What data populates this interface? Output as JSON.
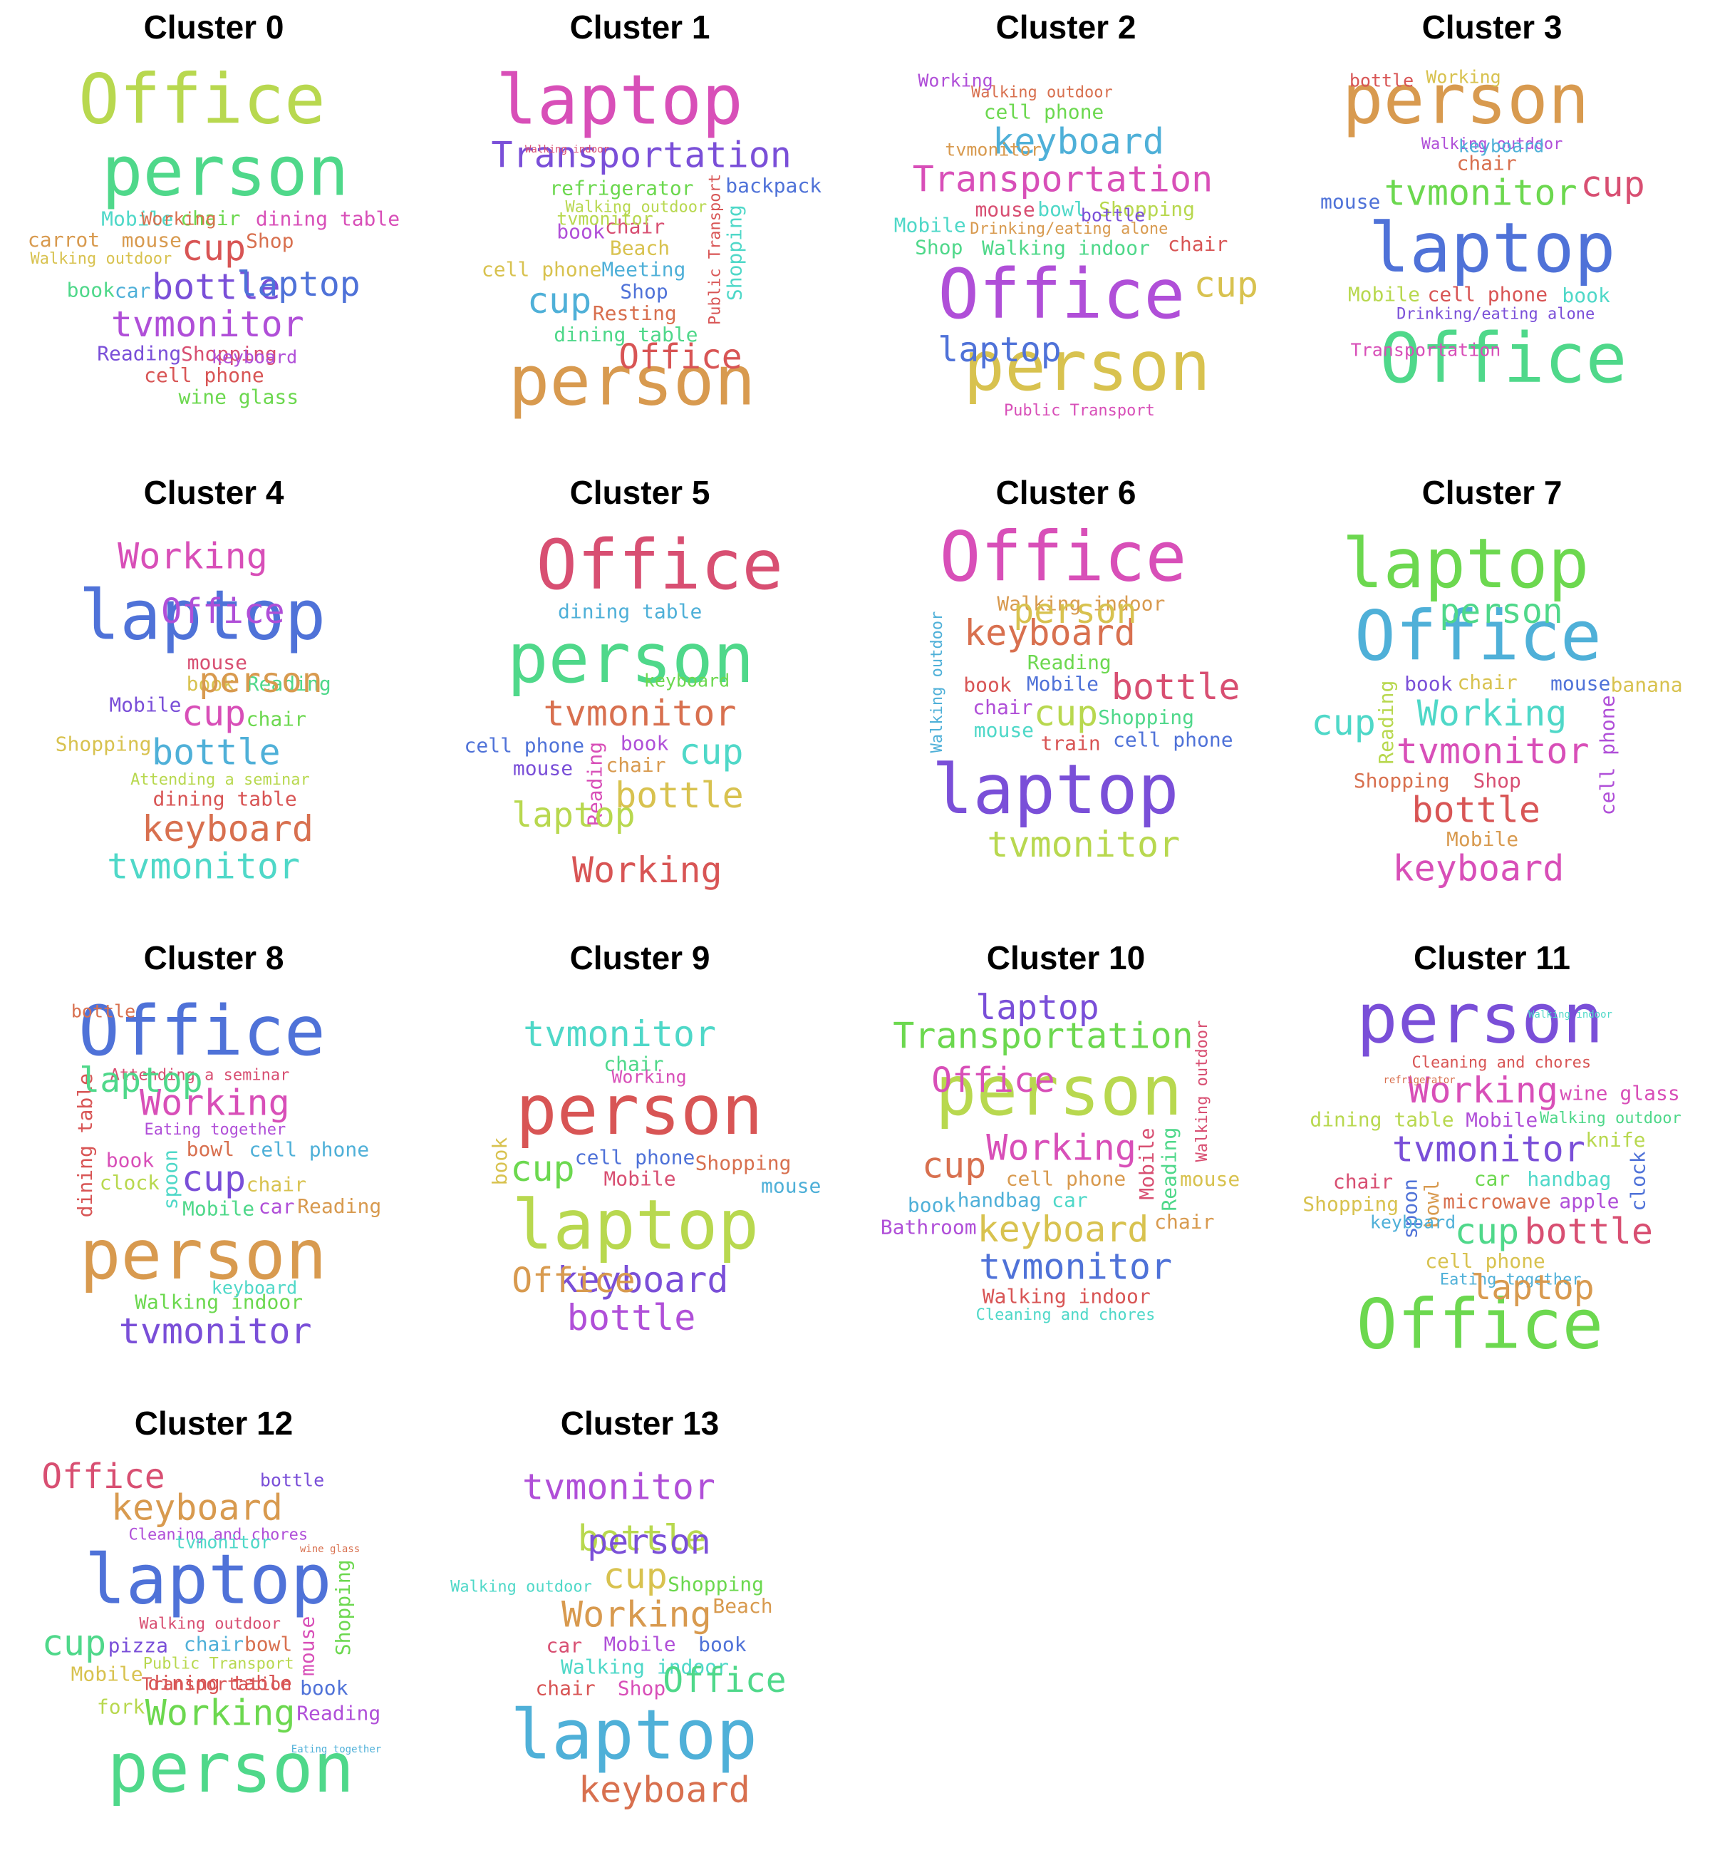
{
  "palette": [
    "#d85555",
    "#d8704f",
    "#d89a4f",
    "#d8c24f",
    "#b8d84f",
    "#6cd84f",
    "#4fd88a",
    "#4fd8c8",
    "#4fb0d8",
    "#4f72d8",
    "#7a4fd8",
    "#b04fd8",
    "#d84fb8",
    "#d84f72"
  ],
  "clusters": [
    {
      "title": "Cluster 0",
      "words": [
        "cup",
        "chair",
        "bottle",
        "Shop",
        "person",
        "tvmonitor",
        "mouse",
        "Mobile",
        "dining table",
        "Walking outdoor",
        "car",
        "Shopping",
        "Office",
        "laptop",
        "cell phone",
        "wine glass",
        "Reading",
        "Working",
        "book",
        "keyboard",
        "carrot"
      ]
    },
    {
      "title": "Cluster 1",
      "words": [
        "Beach",
        "Meeting",
        "chair",
        "Walking outdoor",
        "Shop",
        "Public Transport",
        "refrigerator",
        "Transportation",
        "Resting",
        "dining table",
        "book",
        "person",
        "Shopping",
        "laptop",
        "cell phone",
        "cup",
        "Walking indoor",
        "tvmonitor",
        "backpack",
        "Office"
      ]
    },
    {
      "title": "Cluster 2",
      "words": [
        "Walking indoor",
        "Office",
        "Drinking/eating alone",
        "bowl",
        "Transportation",
        "person",
        "keyboard",
        "mouse",
        "Shopping",
        "laptop",
        "chair",
        "cell phone",
        "bottle",
        "Walking outdoor",
        "Shop",
        "Working",
        "tvmonitor",
        "Mobile",
        "Public Transport",
        "cup"
      ]
    },
    {
      "title": "Cluster 3",
      "words": [
        "laptop",
        "cell phone",
        "tvmonitor",
        "Drinking/eating alone",
        "chair",
        "Office",
        "Walking outdoor",
        "person",
        "book",
        "Transportation",
        "Working",
        "keyboard",
        "cup",
        "Mobile",
        "mouse",
        "bottle"
      ]
    },
    {
      "title": "Cluster 4",
      "words": [
        "cup",
        "book",
        "bottle",
        "mouse",
        "Attending a seminar",
        "laptop",
        "dining table",
        "chair",
        "Mobile",
        "keyboard",
        "Reading",
        "Office",
        "person",
        "tvmonitor",
        "Working",
        "Shopping"
      ]
    },
    {
      "title": "Cluster 5",
      "words": [
        "tvmonitor",
        "person",
        "book",
        "chair",
        "cup",
        "Reading",
        "bottle",
        "dining table",
        "Office",
        "laptop",
        "cell phone",
        "Working",
        "keyboard",
        "mouse"
      ]
    },
    {
      "title": "Cluster 6",
      "words": [
        "cup",
        "Mobile",
        "train",
        "Reading",
        "laptop",
        "keyboard",
        "Shopping",
        "chair",
        "Walking indoor",
        "mouse",
        "Office",
        "person",
        "Walking outdoor",
        "bottle",
        "tvmonitor",
        "cell phone",
        "book"
      ]
    },
    {
      "title": "Cluster 7",
      "words": [
        "Working",
        "tvmonitor",
        "chair",
        "Office",
        "Shop",
        "Reading",
        "mouse",
        "bottle",
        "laptop",
        "book",
        "Shopping",
        "person",
        "cell phone",
        "Mobile",
        "cup",
        "keyboard",
        "banana"
      ]
    },
    {
      "title": "Cluster 8",
      "words": [
        "cup",
        "bowl",
        "Mobile",
        "Eating together",
        "person",
        "spoon",
        "Working",
        "chair",
        "cell phone",
        "Attending a seminar",
        "clock",
        "Office",
        "dining table",
        "Walking indoor",
        "tvmonitor",
        "bottle",
        "laptop",
        "car",
        "Reading",
        "keyboard",
        "book"
      ]
    },
    {
      "title": "Cluster 9",
      "words": [
        "Mobile",
        "laptop",
        "cell phone",
        "person",
        "cup",
        "keyboard",
        "Shopping",
        "chair",
        "bottle",
        "Office",
        "tvmonitor",
        "Working",
        "book",
        "mouse"
      ]
    },
    {
      "title": "Cluster 10",
      "words": [
        "cell phone",
        "car",
        "Working",
        "keyboard",
        "handbag",
        "Mobile",
        "person",
        "tvmonitor",
        "Walking indoor",
        "Transportation",
        "laptop",
        "cup",
        "Reading",
        "Bathroom",
        "chair",
        "Cleaning and chores",
        "Office",
        "mouse",
        "book",
        "Walking outdoor"
      ]
    },
    {
      "title": "Cluster 11",
      "words": [
        "car",
        "tvmonitor",
        "microwave",
        "cup",
        "Mobile",
        "bowl",
        "handbag",
        "Working",
        "cell phone",
        "Eating together",
        "bottle",
        "dining table",
        "spoon",
        "Cleaning and chores",
        "Office",
        "person",
        "refrigerator",
        "Walking outdoor",
        "apple",
        "laptop",
        "Walking indoor",
        "wine glass",
        "Shopping",
        "keyboard",
        "chair",
        "knife",
        "clock"
      ]
    },
    {
      "title": "Cluster 12",
      "words": [
        "chair",
        "Walking outdoor",
        "Public Transport",
        "laptop",
        "dining table",
        "Working",
        "pizza",
        "bowl",
        "person",
        "Cleaning and chores",
        "keyboard",
        "tvmonitor",
        "mouse",
        "Mobile",
        "Eating together",
        "Office",
        "fork",
        "book",
        "Transportation",
        "Shopping",
        "bottle",
        "wine glass",
        "cup",
        "Reading"
      ]
    },
    {
      "title": "Cluster 13",
      "words": [
        "Mobile",
        "Working",
        "Walking indoor",
        "Shop",
        "cup",
        "laptop",
        "car",
        "bottle",
        "book",
        "chair",
        "Shopping",
        "person",
        "keyboard",
        "Office",
        "tvmonitor",
        "Beach",
        "Walking outdoor"
      ]
    }
  ]
}
